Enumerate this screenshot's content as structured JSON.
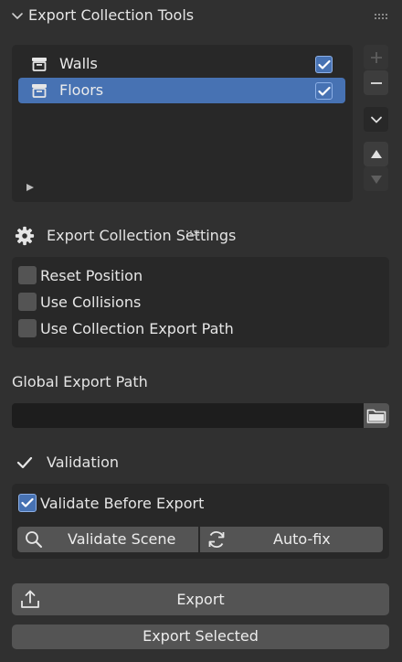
{
  "panel": {
    "title": "Export Collection Tools",
    "chevron_icon": "chevron-down-icon"
  },
  "collection_list": {
    "items": [
      {
        "label": "Walls",
        "checked": true,
        "active": false,
        "icon": "collection-icon"
      },
      {
        "label": "Floors",
        "checked": true,
        "active": true,
        "icon": "collection-icon"
      }
    ],
    "side_buttons": [
      "plus-icon",
      "minus-icon",
      "chevron-down-icon",
      "arrow-up-icon",
      "arrow-down-icon"
    ]
  },
  "settings": {
    "heading": "Export Collection Settings",
    "heading_icon": "gear-icon",
    "options": [
      {
        "label": "Reset Position",
        "checked": false
      },
      {
        "label": "Use Collisions",
        "checked": false
      },
      {
        "label": "Use Collection Export Path",
        "checked": false
      }
    ]
  },
  "export_path": {
    "label": "Global Export Path",
    "value": "",
    "button_icon": "folder-icon"
  },
  "validation": {
    "heading": "Validation",
    "heading_icon": "checkmark-icon",
    "validate_before_export": {
      "label": "Validate Before Export",
      "checked": true
    },
    "validate_scene_button": "Validate Scene",
    "autofix_button": "Auto-fix"
  },
  "actions": {
    "export_button": "Export",
    "export_selected_button": "Export Selected"
  },
  "colors": {
    "background": "#303030",
    "accent": "#4772b3",
    "box": "#282828",
    "button": "#545454"
  }
}
